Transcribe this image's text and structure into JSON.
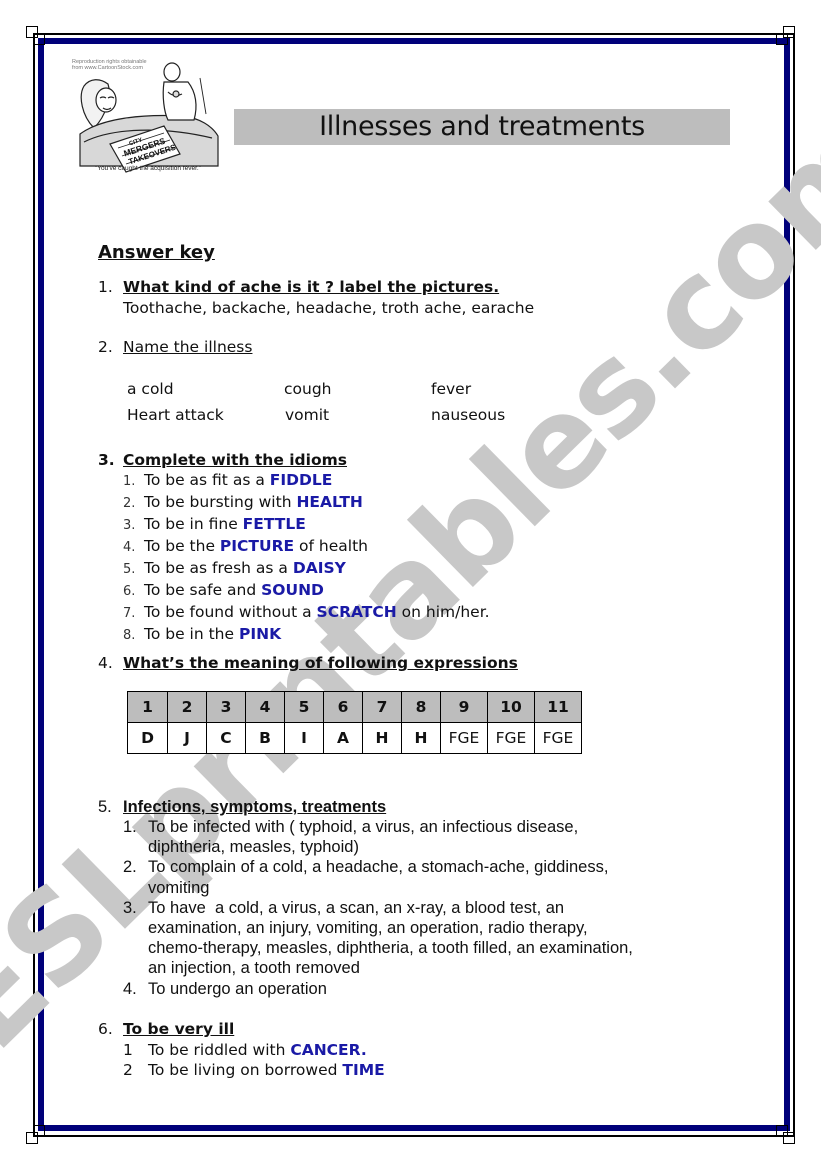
{
  "watermark": "ESLprintables.com",
  "header": {
    "title": "Illnesses and treatments",
    "cartoon_credit": "Reproduction rights obtainable from www.CartoonStock.com",
    "cartoon_caption": "\"You've caught the acquisition fever.\"",
    "cartoon_newspaper": [
      "CITY",
      "MERGERS",
      "TAKEOVERS"
    ]
  },
  "answer_key_title": "Answer key",
  "section1": {
    "num": "1.",
    "heading": "What kind of ache is it ? label the pictures.",
    "answer": "Toothache, backache, headache, troth ache, earache"
  },
  "section2": {
    "num": "2.",
    "heading": "Name the illness",
    "rows": [
      [
        "a cold",
        "cough",
        "fever"
      ],
      [
        "Heart attack",
        "vomit",
        "nauseous"
      ]
    ]
  },
  "section3": {
    "num": "3.",
    "heading": "Complete with the idioms",
    "items": [
      {
        "n": "1.",
        "before": "To be as fit as a ",
        "answer": "FIDDLE",
        "after": ""
      },
      {
        "n": "2.",
        "before": "To be bursting with ",
        "answer": "HEALTH",
        "after": ""
      },
      {
        "n": "3.",
        "before": "To be in fine ",
        "answer": "FETTLE",
        "after": ""
      },
      {
        "n": "4.",
        "before": "To be the ",
        "answer": "PICTURE",
        "after": " of health"
      },
      {
        "n": "5.",
        "before": "To be as fresh as a ",
        "answer": "DAISY",
        "after": ""
      },
      {
        "n": "6.",
        "before": "To be safe and ",
        "answer": "SOUND",
        "after": ""
      },
      {
        "n": "7.",
        "before": "To be found without a ",
        "answer": "SCRATCH",
        "after": " on him/her."
      },
      {
        "n": "8.",
        "before": "To be in the ",
        "answer": "PINK",
        "after": ""
      }
    ]
  },
  "section4": {
    "num": "4.",
    "heading": "What’s the meaning of following expressions",
    "table": {
      "headers": [
        "1",
        "2",
        "3",
        "4",
        "5",
        "6",
        "7",
        "8",
        "9",
        "10",
        "11"
      ],
      "values": [
        "D",
        "J",
        "C",
        "B",
        "I",
        "A",
        "H",
        "H",
        "FGE",
        "FGE",
        "FGE"
      ]
    }
  },
  "section5": {
    "num": "5.",
    "heading": "Infections, symptoms, treatments",
    "items": [
      {
        "n": "1.",
        "lines": [
          "To be infected with ( typhoid, a virus, an infectious disease,",
          "diphtheria, measles, typhoid)"
        ]
      },
      {
        "n": "2.",
        "lines": [
          "To complain of a cold, a headache, a stomach-ache, giddiness,",
          "vomiting"
        ]
      },
      {
        "n": "3.",
        "lines": [
          "To have  a cold, a virus, a scan, an x-ray, a blood test, an",
          "examination, an injury, vomiting, an operation, radio therapy,",
          "chemo-therapy, measles, diphtheria, a tooth filled, an examination,",
          "an injection, a tooth removed"
        ]
      },
      {
        "n": "4.",
        "lines": [
          "To undergo an operation"
        ]
      }
    ]
  },
  "section6": {
    "num": "6.",
    "heading": "To be very ill",
    "items": [
      {
        "n": "1",
        "before": "To be riddled with ",
        "answer": "CANCER."
      },
      {
        "n": "2",
        "before": "To be living on borrowed ",
        "answer": "TIME"
      }
    ]
  },
  "colors": {
    "border_navy": "#00007a",
    "answer_blue": "#1a1aa6",
    "title_bar_gray": "#bdbdbd",
    "watermark_gray": "#c8c8c8"
  }
}
